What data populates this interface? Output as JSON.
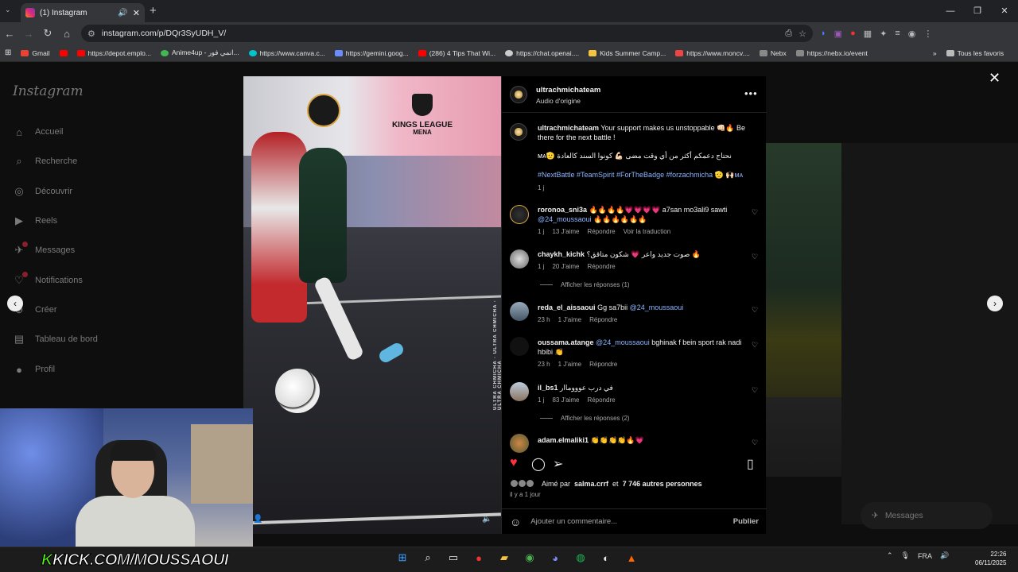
{
  "browser": {
    "tab_title": "(1) Instagram",
    "url": "instagram.com/p/DQr3SyUDH_V/",
    "bookmarks": [
      "Gmail",
      "https://depot.emplo...",
      "Anime4up - انمي فور...",
      "https://www.canva.c...",
      "https://gemini.goog...",
      "(286) 4 Tips That Wi...",
      "https://chat.openai....",
      "Kids Summer Camp...",
      "https://www.moncv....",
      "Nebx",
      "https://nebx.io/event"
    ],
    "all_favorites": "Tous les favoris"
  },
  "sidebar": {
    "logo": "Instagram",
    "items": [
      {
        "label": "Accueil",
        "icon": "⌂"
      },
      {
        "label": "Recherche",
        "icon": "⌕"
      },
      {
        "label": "Découvrir",
        "icon": "◎"
      },
      {
        "label": "Reels",
        "icon": "▶"
      },
      {
        "label": "Messages",
        "icon": "✈"
      },
      {
        "label": "Notifications",
        "icon": "♡"
      },
      {
        "label": "Créer",
        "icon": "⊕"
      },
      {
        "label": "Tableau de bord",
        "icon": "▤"
      },
      {
        "label": "Profil",
        "icon": "●"
      }
    ]
  },
  "video": {
    "league_title": "KINGS LEAGUE",
    "league_sub": "MENA",
    "side_text": "ULTRA CHMICHA · ULTRA CHMICHA · ULTRA CHMICHA"
  },
  "post": {
    "author": "ultrachmichateam",
    "audio": "Audio d'origine",
    "caption_user": "ultrachmichateam",
    "caption_text": "Your support makes us unstoppable 👊🏻🔥 Be there for the next battle !",
    "caption_arabic": "نحتاج دعمكم أكثر من أي وقت مضى 💪🏻 كونوا السند كالعادة 🫡ᴍᴀ",
    "hashtags": "#NextBattle #TeamSpirit #ForTheBadge #forzachmicha 🫡 🙌🏻ᴍᴀ",
    "caption_time": "1 j"
  },
  "comments": [
    {
      "user": "roronoa_sni3a",
      "text": "🔥🔥🔥🔥💗💗💗💗 a7san mo3ali9 sawti",
      "mention": "@24_moussaoui",
      "after": "🔥🔥🔥🔥🔥🔥",
      "time": "1 j",
      "likes": "13 J'aime",
      "reply": "Répondre",
      "extra": "Voir la traduction"
    },
    {
      "user": "chaykh_kichk",
      "text": "صوت جديد واعر 💗 شكون متاقق؟ 🔥",
      "time": "1 j",
      "likes": "20 J'aime",
      "reply": "Répondre",
      "show_replies": "Afficher les réponses (1)"
    },
    {
      "user": "reda_el_aissaoui",
      "text": "Gg sa7bii",
      "mention": "@24_moussaoui",
      "time": "23 h",
      "likes": "1 J'aime",
      "reply": "Répondre"
    },
    {
      "user": "oussama.atange",
      "mention": "@24_moussaoui",
      "text": "bghinak f bein sport rak nadi hbibi 👏",
      "time": "23 h",
      "likes": "1 J'aime",
      "reply": "Répondre"
    },
    {
      "user": "il_bs1",
      "text": "في درب عوووماار",
      "time": "1 j",
      "likes": "83 J'aime",
      "reply": "Répondre",
      "show_replies": "Afficher les réponses (2)"
    },
    {
      "user": "adam.elmaliki1",
      "text": "👏👏👏👏🔥💗"
    }
  ],
  "footer": {
    "liked_prefix": "Aimé par",
    "liked_user": "salma.crrf",
    "liked_mid": "et",
    "liked_count": "7 746 autres personnes",
    "time": "il y a 1 jour",
    "comment_placeholder": "Ajouter un commentaire...",
    "publish": "Publier"
  },
  "messages_pill": "Messages",
  "stream": {
    "kick_brand": "K",
    "kick_text": "KICK.COM/MOUSSAOUI"
  },
  "taskbar": {
    "lang": "FRA",
    "time": "22:26",
    "date": "06/11/2025"
  },
  "colors": {
    "like_red": "#ff3040",
    "link_blue": "#8ab4ff",
    "kick_green": "#53fc18"
  }
}
